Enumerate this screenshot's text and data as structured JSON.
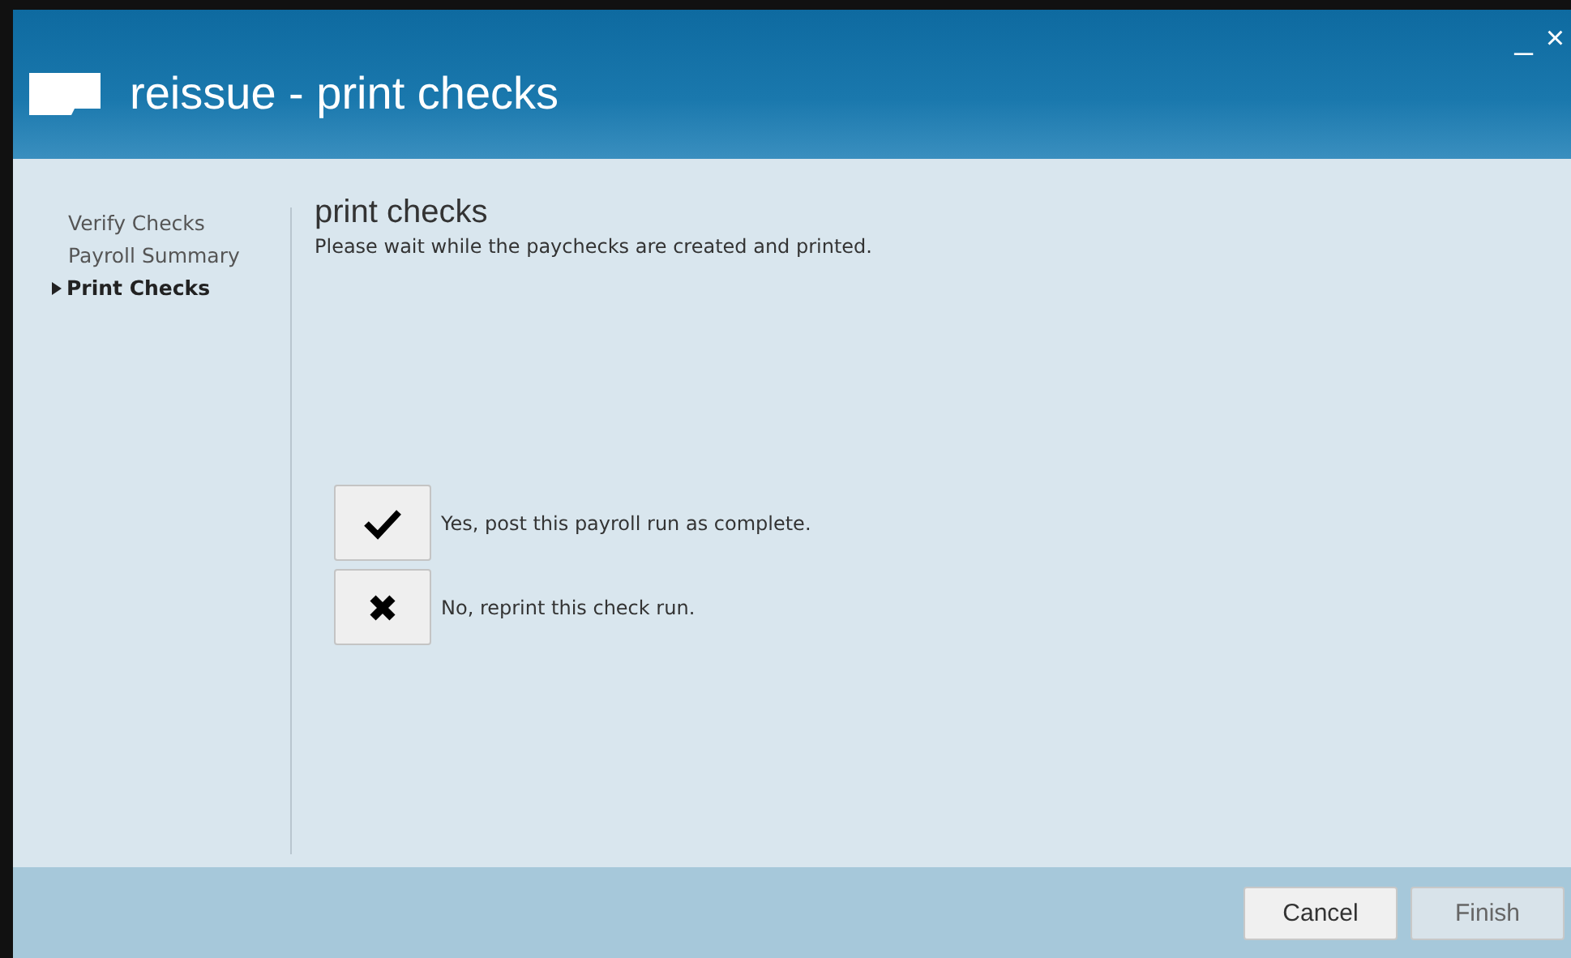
{
  "window": {
    "title": "reissue - print checks",
    "controls": [
      "_",
      "×"
    ]
  },
  "steps": [
    {
      "label": "Verify Checks",
      "selected": false
    },
    {
      "label": "Payroll Summary",
      "selected": false
    },
    {
      "label": "Print Checks",
      "selected": true
    }
  ],
  "page": {
    "heading": "print checks",
    "message": "Please wait while the paychecks are created and printed."
  },
  "choices": [
    {
      "kind": "check",
      "label": "Yes, post this payroll run as complete."
    },
    {
      "kind": "cross",
      "label": "No, reprint this check run."
    }
  ],
  "buttons": [
    {
      "label": "Cancel",
      "disabled": false
    },
    {
      "label": "Finish",
      "disabled": true
    }
  ]
}
